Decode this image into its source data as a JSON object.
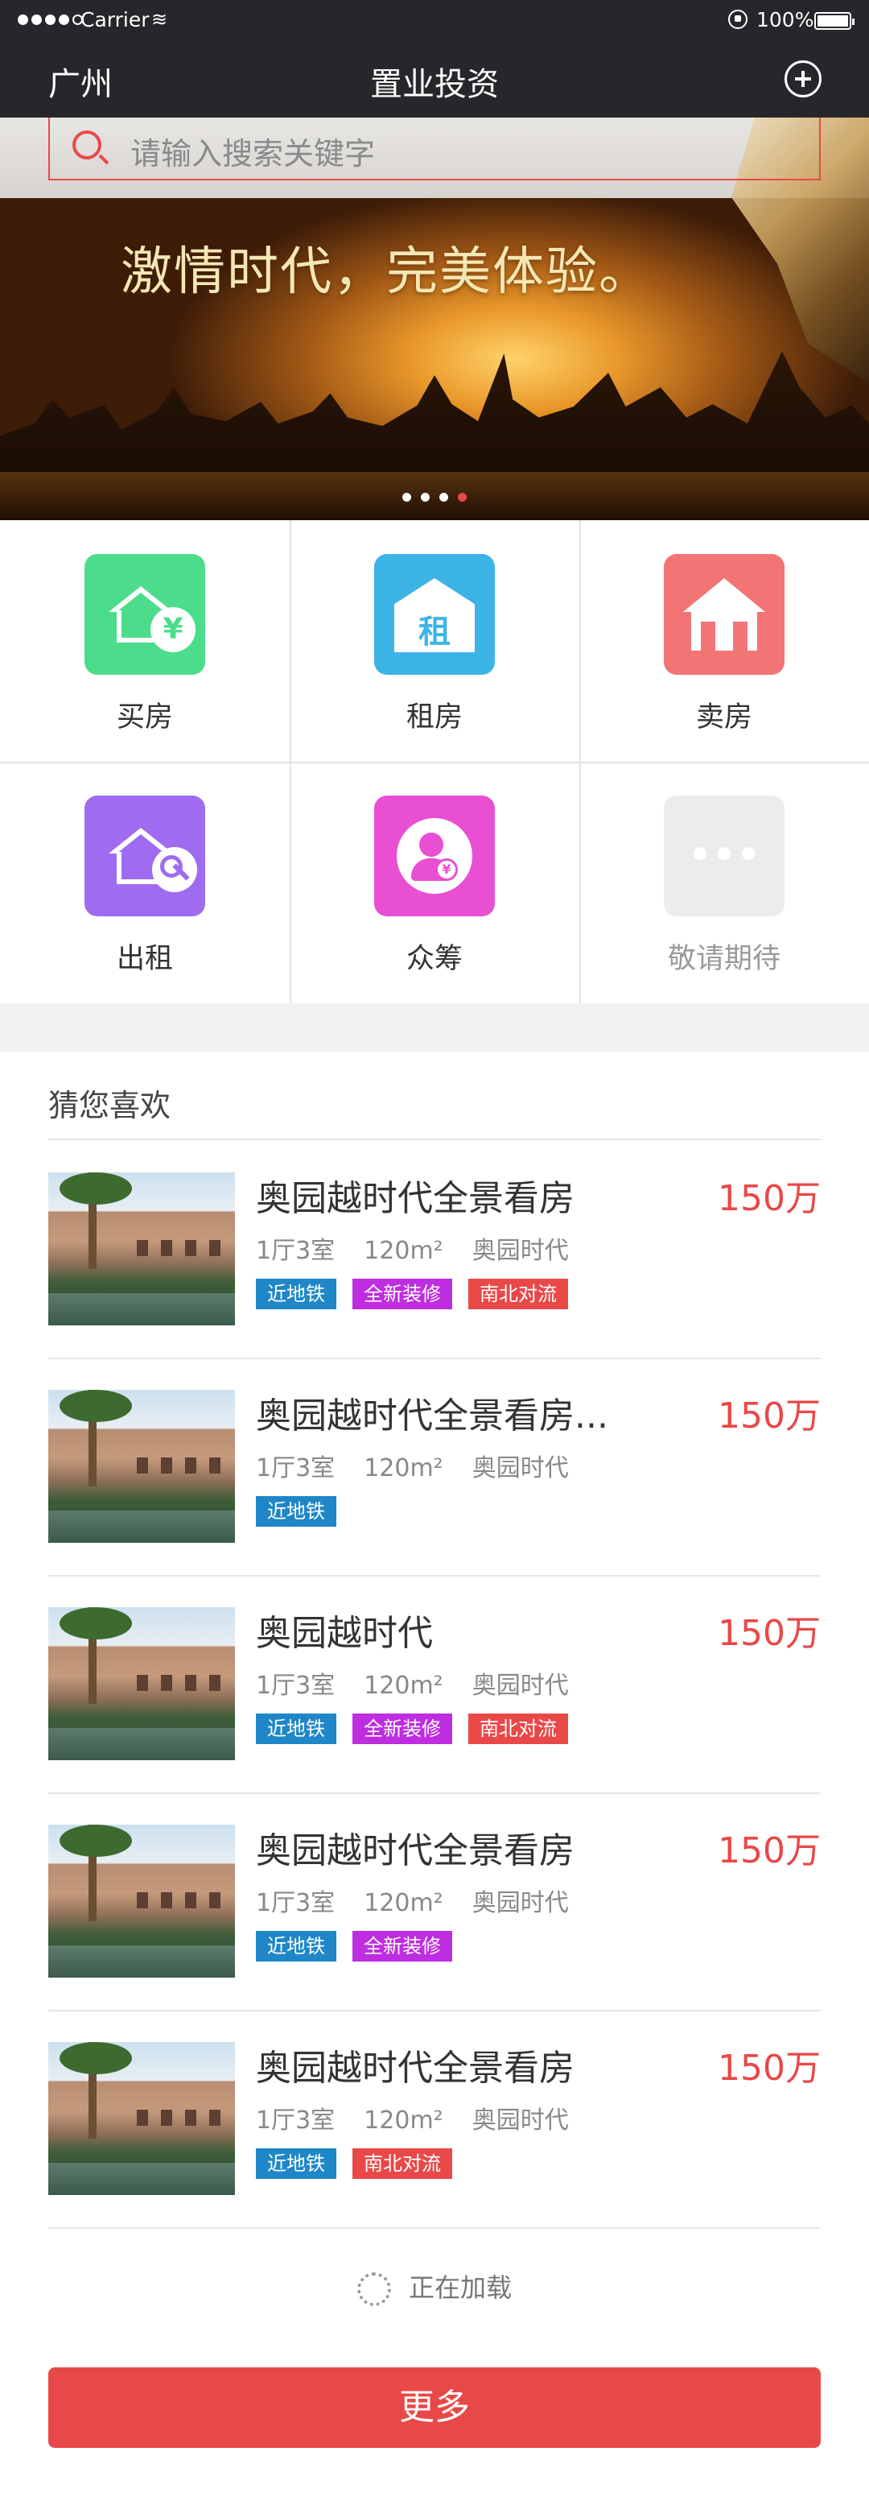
{
  "status_bar": {
    "carrier": "Carrier",
    "battery": "100%"
  },
  "nav": {
    "city": "广州",
    "title": "置业投资"
  },
  "search": {
    "placeholder": "请输入搜索关键字"
  },
  "banner": {
    "headline": "激情时代，完美体验。",
    "slide_count": 4,
    "active_slide": 4
  },
  "services": [
    {
      "label": "买房",
      "icon": "buy-house-icon",
      "color": "#4bdd8b"
    },
    {
      "label": "租房",
      "icon": "rent-house-icon",
      "color": "#3cb4e6",
      "glyph": "租"
    },
    {
      "label": "卖房",
      "icon": "sell-house-icon",
      "color": "#f27474"
    },
    {
      "label": "出租",
      "icon": "lease-out-icon",
      "color": "#9f6bf0"
    },
    {
      "label": "众筹",
      "icon": "crowdfunding-icon",
      "color": "#e84fd2",
      "glyph": "¥"
    },
    {
      "label": "敬请期待",
      "icon": "more-dots-icon",
      "color": "#ececec"
    }
  ],
  "recommend": {
    "title": "猜您喜欢",
    "items": [
      {
        "name": "奥园越时代全景看房",
        "price": "150万",
        "layout": "1厅3室",
        "area": "120m²",
        "community": "奥园时代",
        "tags": [
          {
            "text": "近地铁",
            "color": "blue"
          },
          {
            "text": "全新装修",
            "color": "purple"
          },
          {
            "text": "南北对流",
            "color": "red"
          }
        ]
      },
      {
        "name": "奥园越时代全景看房...",
        "price": "150万",
        "layout": "1厅3室",
        "area": "120m²",
        "community": "奥园时代",
        "tags": [
          {
            "text": "近地铁",
            "color": "blue"
          }
        ]
      },
      {
        "name": "奥园越时代",
        "price": "150万",
        "layout": "1厅3室",
        "area": "120m²",
        "community": "奥园时代",
        "tags": [
          {
            "text": "近地铁",
            "color": "blue"
          },
          {
            "text": "全新装修",
            "color": "purple"
          },
          {
            "text": "南北对流",
            "color": "red"
          }
        ]
      },
      {
        "name": "奥园越时代全景看房",
        "price": "150万",
        "layout": "1厅3室",
        "area": "120m²",
        "community": "奥园时代",
        "tags": [
          {
            "text": "近地铁",
            "color": "blue"
          },
          {
            "text": "全新装修",
            "color": "purple"
          }
        ]
      },
      {
        "name": "奥园越时代全景看房",
        "price": "150万",
        "layout": "1厅3室",
        "area": "120m²",
        "community": "奥园时代",
        "tags": [
          {
            "text": "近地铁",
            "color": "blue"
          },
          {
            "text": "南北对流",
            "color": "red"
          }
        ]
      }
    ]
  },
  "loading_text": "正在加载",
  "more_button": "更多"
}
